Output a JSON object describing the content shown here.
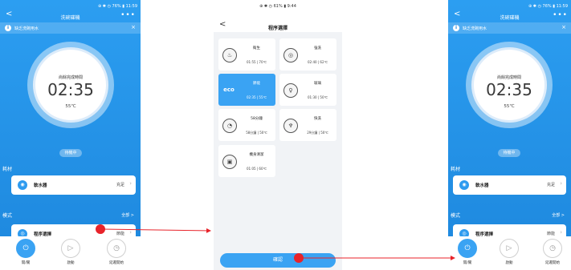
{
  "left": {
    "status_bar": "⊕ ✱ ◷ 76% ▮ 11:59",
    "title": "洗碗碟機",
    "back": "<",
    "more": "•••",
    "notice": "缺乏洗碗用水",
    "notice_close": "×",
    "remain_label": "尚餘完成時間",
    "time": "02:35",
    "temp": "55℃",
    "standby": "待機中",
    "consumables_title": "耗材",
    "softener_label": "軟水器",
    "softener_status": "充足",
    "mode_title": "模式",
    "mode_all": "全部 >",
    "program_label": "程序選擇",
    "program_value": "節能"
  },
  "middle": {
    "status_bar": "⊕ ✱ ◷ 61% ▮ 9:44",
    "title": "程序選擇",
    "back": "<",
    "programs": [
      {
        "name": "衛生",
        "detail": "01:55 | 70℃",
        "icon": "♨"
      },
      {
        "name": "強洗",
        "detail": "02:40 | 62℃",
        "icon": "◎"
      },
      {
        "name": "節能",
        "detail": "02:35 | 55℃",
        "icon": "eco"
      },
      {
        "name": "玻璃",
        "detail": "01:30 | 50℃",
        "icon": "♀"
      },
      {
        "name": "58分鐘",
        "detail": "58分鐘 | 50℃",
        "icon": "◔"
      },
      {
        "name": "快洗",
        "detail": "29分鐘 | 50℃",
        "icon": "♆"
      },
      {
        "name": "機身清潔",
        "detail": "01:05 | 60℃",
        "icon": "▣"
      }
    ],
    "confirm": "確認"
  },
  "right": {
    "status_bar": "⊕ ✱ ◷ 76% ▮ 11:59",
    "title": "洗碗碟機",
    "back": "<",
    "more": "•••",
    "notice": "缺乏洗碗用水",
    "notice_close": "×",
    "remain_label": "尚餘完成時間",
    "time": "02:35",
    "temp": "55℃",
    "standby": "待機中",
    "consumables_title": "耗材",
    "softener_label": "軟水器",
    "softener_status": "充足",
    "mode_title": "模式",
    "mode_all": "全部 >",
    "program_label": "程序選擇",
    "program_value": "節能"
  },
  "bottom_bar": {
    "power": "開/關",
    "start": "啟動",
    "delay": "延遲開始"
  },
  "colors": {
    "accent": "#2c9ef1",
    "pointer": "#e8232a"
  }
}
